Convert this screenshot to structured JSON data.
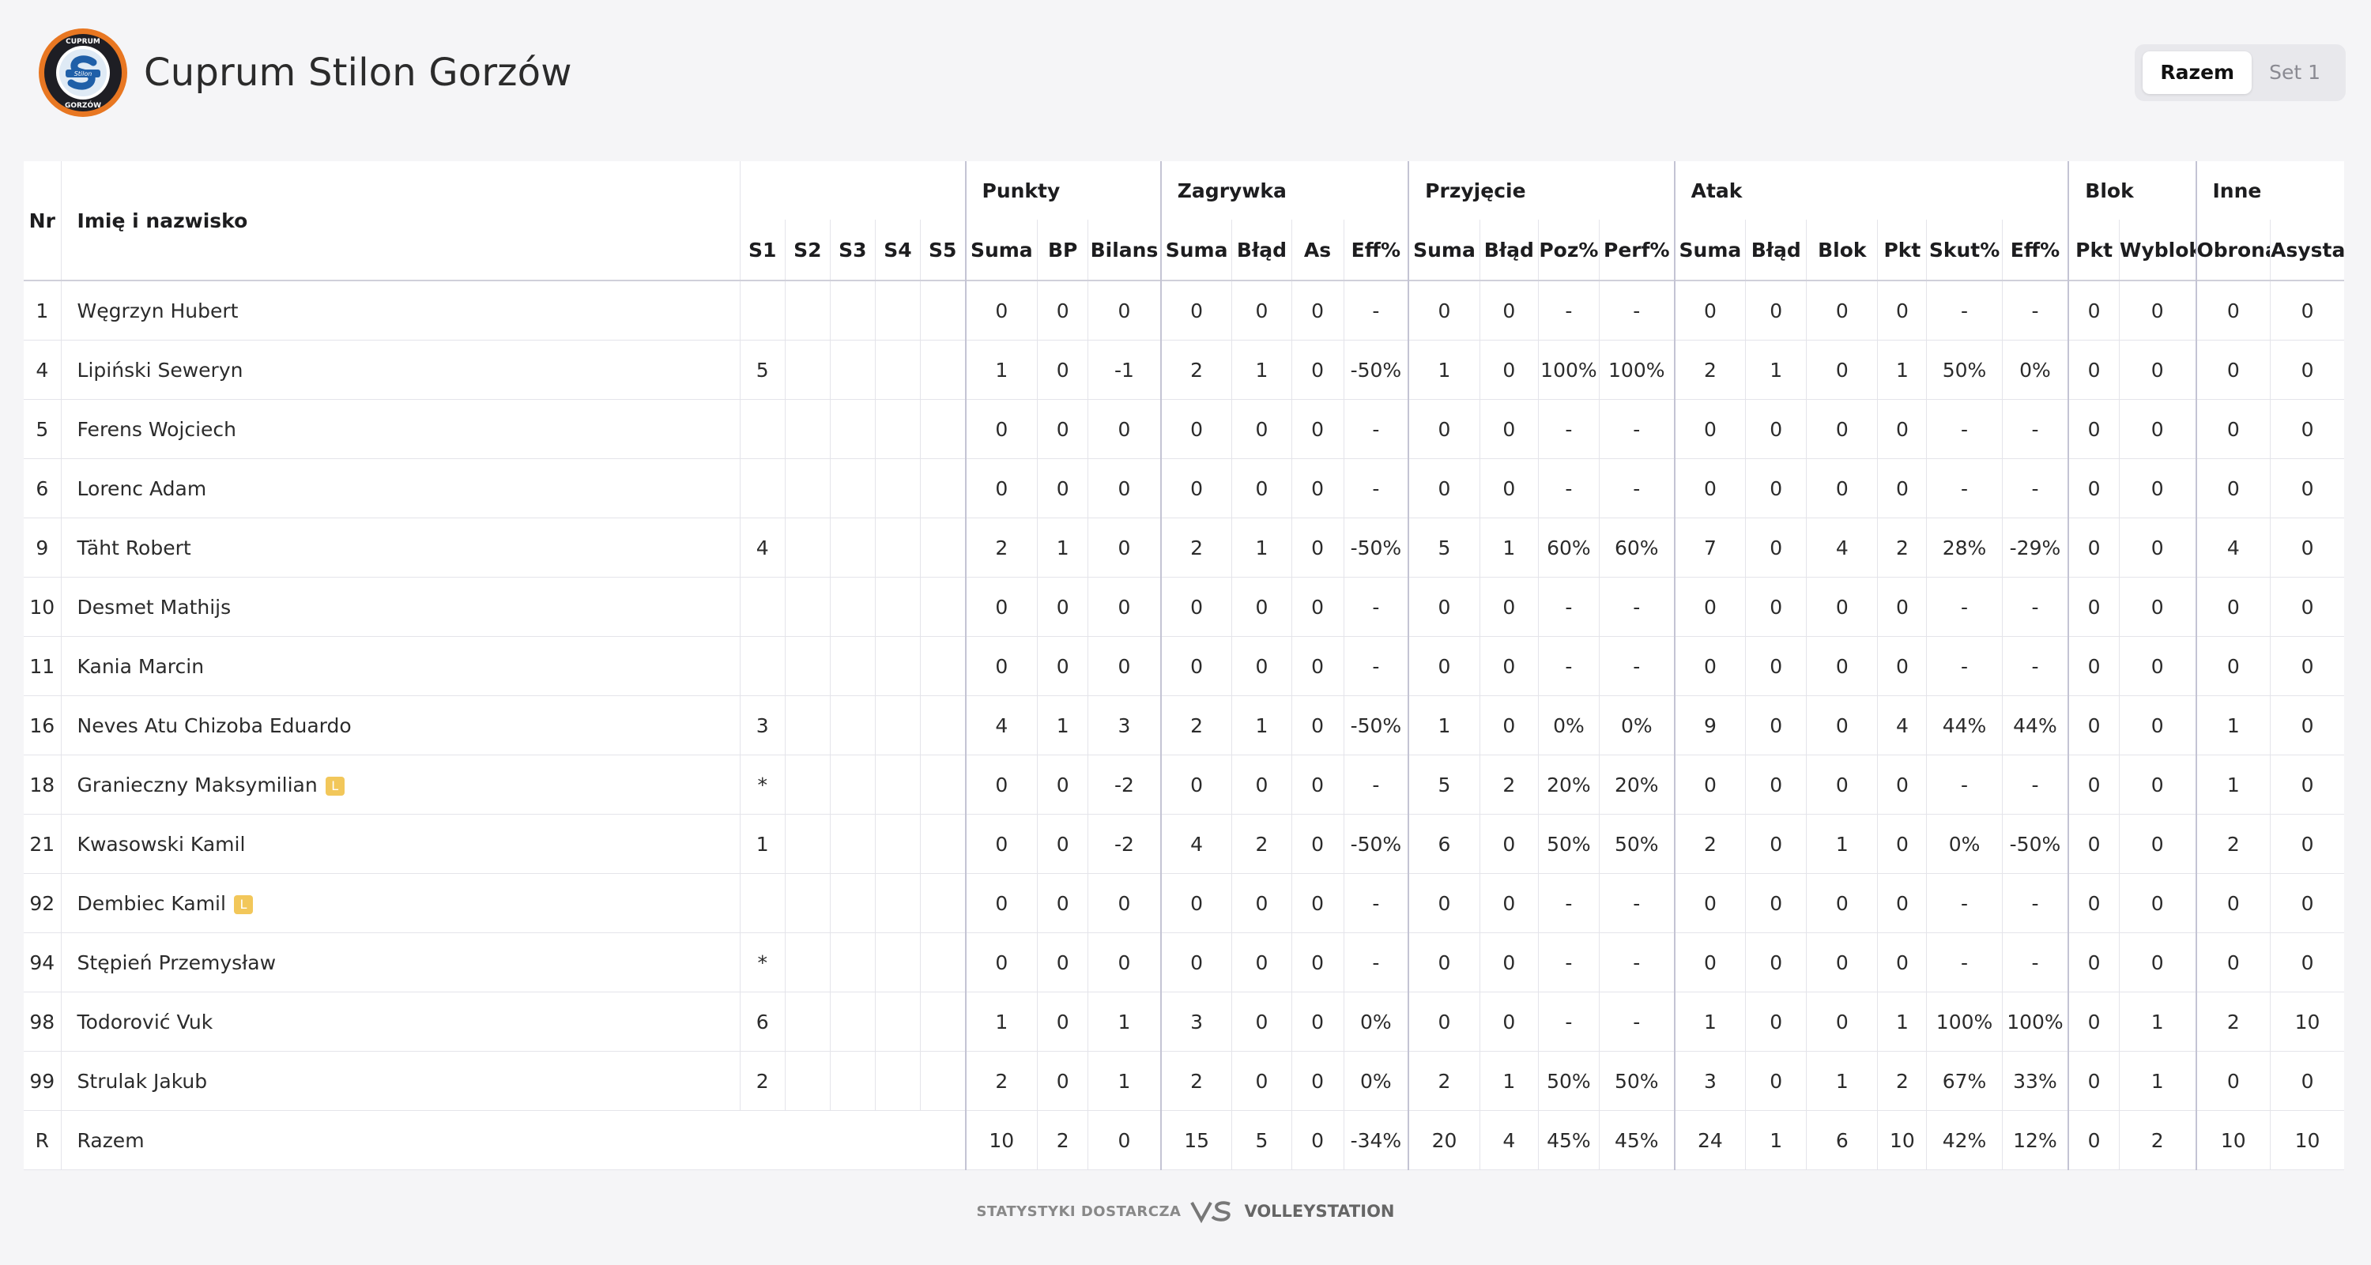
{
  "team": {
    "name": "Cuprum Stilon Gorzów",
    "logo_text_top": "CUPRUM",
    "logo_text_bottom": "GORZÓW",
    "logo_text_mid": "Stilon"
  },
  "tabs": [
    {
      "label": "Razem",
      "active": true
    },
    {
      "label": "Set 1",
      "active": false
    }
  ],
  "table": {
    "headers": {
      "nr": "Nr",
      "name": "Imię i nazwisko",
      "groups": [
        "",
        "Punkty",
        "Zagrywka",
        "Przyjęcie",
        "Atak",
        "Blok",
        "Inne"
      ],
      "columns": [
        "S1",
        "S2",
        "S3",
        "S4",
        "S5",
        "Suma",
        "BP",
        "Bilans",
        "Suma",
        "Błąd",
        "As",
        "Eff%",
        "Suma",
        "Błąd",
        "Poz%",
        "Perf%",
        "Suma",
        "Błąd",
        "Blok",
        "Pkt",
        "Skut%",
        "Eff%",
        "Pkt",
        "Wyblok",
        "Obrona",
        "Asysta"
      ]
    },
    "rows": [
      {
        "nr": "1",
        "name": "Węgrzyn Hubert",
        "libero": false,
        "cells": [
          "",
          "",
          "",
          "",
          "",
          "0",
          "0",
          "0",
          "0",
          "0",
          "0",
          "-",
          "0",
          "0",
          "-",
          "-",
          "0",
          "0",
          "0",
          "0",
          "-",
          "-",
          "0",
          "0",
          "0",
          "0"
        ]
      },
      {
        "nr": "4",
        "name": "Lipiński Seweryn",
        "libero": false,
        "cells": [
          "5",
          "",
          "",
          "",
          "",
          "1",
          "0",
          "-1",
          "2",
          "1",
          "0",
          "-50%",
          "1",
          "0",
          "100%",
          "100%",
          "2",
          "1",
          "0",
          "1",
          "50%",
          "0%",
          "0",
          "0",
          "0",
          "0"
        ]
      },
      {
        "nr": "5",
        "name": "Ferens Wojciech",
        "libero": false,
        "cells": [
          "",
          "",
          "",
          "",
          "",
          "0",
          "0",
          "0",
          "0",
          "0",
          "0",
          "-",
          "0",
          "0",
          "-",
          "-",
          "0",
          "0",
          "0",
          "0",
          "-",
          "-",
          "0",
          "0",
          "0",
          "0"
        ]
      },
      {
        "nr": "6",
        "name": "Lorenc Adam",
        "libero": false,
        "cells": [
          "",
          "",
          "",
          "",
          "",
          "0",
          "0",
          "0",
          "0",
          "0",
          "0",
          "-",
          "0",
          "0",
          "-",
          "-",
          "0",
          "0",
          "0",
          "0",
          "-",
          "-",
          "0",
          "0",
          "0",
          "0"
        ]
      },
      {
        "nr": "9",
        "name": "Täht Robert",
        "libero": false,
        "cells": [
          "4",
          "",
          "",
          "",
          "",
          "2",
          "1",
          "0",
          "2",
          "1",
          "0",
          "-50%",
          "5",
          "1",
          "60%",
          "60%",
          "7",
          "0",
          "4",
          "2",
          "28%",
          "-29%",
          "0",
          "0",
          "4",
          "0"
        ]
      },
      {
        "nr": "10",
        "name": "Desmet Mathijs",
        "libero": false,
        "cells": [
          "",
          "",
          "",
          "",
          "",
          "0",
          "0",
          "0",
          "0",
          "0",
          "0",
          "-",
          "0",
          "0",
          "-",
          "-",
          "0",
          "0",
          "0",
          "0",
          "-",
          "-",
          "0",
          "0",
          "0",
          "0"
        ]
      },
      {
        "nr": "11",
        "name": "Kania Marcin",
        "libero": false,
        "cells": [
          "",
          "",
          "",
          "",
          "",
          "0",
          "0",
          "0",
          "0",
          "0",
          "0",
          "-",
          "0",
          "0",
          "-",
          "-",
          "0",
          "0",
          "0",
          "0",
          "-",
          "-",
          "0",
          "0",
          "0",
          "0"
        ]
      },
      {
        "nr": "16",
        "name": "Neves Atu Chizoba Eduardo",
        "libero": false,
        "cells": [
          "3",
          "",
          "",
          "",
          "",
          "4",
          "1",
          "3",
          "2",
          "1",
          "0",
          "-50%",
          "1",
          "0",
          "0%",
          "0%",
          "9",
          "0",
          "0",
          "4",
          "44%",
          "44%",
          "0",
          "0",
          "1",
          "0"
        ]
      },
      {
        "nr": "18",
        "name": "Granieczny Maksymilian",
        "libero": true,
        "cells": [
          "*",
          "",
          "",
          "",
          "",
          "0",
          "0",
          "-2",
          "0",
          "0",
          "0",
          "-",
          "5",
          "2",
          "20%",
          "20%",
          "0",
          "0",
          "0",
          "0",
          "-",
          "-",
          "0",
          "0",
          "1",
          "0"
        ]
      },
      {
        "nr": "21",
        "name": "Kwasowski Kamil",
        "libero": false,
        "cells": [
          "1",
          "",
          "",
          "",
          "",
          "0",
          "0",
          "-2",
          "4",
          "2",
          "0",
          "-50%",
          "6",
          "0",
          "50%",
          "50%",
          "2",
          "0",
          "1",
          "0",
          "0%",
          "-50%",
          "0",
          "0",
          "2",
          "0"
        ]
      },
      {
        "nr": "92",
        "name": "Dembiec Kamil",
        "libero": true,
        "cells": [
          "",
          "",
          "",
          "",
          "",
          "0",
          "0",
          "0",
          "0",
          "0",
          "0",
          "-",
          "0",
          "0",
          "-",
          "-",
          "0",
          "0",
          "0",
          "0",
          "-",
          "-",
          "0",
          "0",
          "0",
          "0"
        ]
      },
      {
        "nr": "94",
        "name": "Stępień Przemysław",
        "libero": false,
        "cells": [
          "*",
          "",
          "",
          "",
          "",
          "0",
          "0",
          "0",
          "0",
          "0",
          "0",
          "-",
          "0",
          "0",
          "-",
          "-",
          "0",
          "0",
          "0",
          "0",
          "-",
          "-",
          "0",
          "0",
          "0",
          "0"
        ]
      },
      {
        "nr": "98",
        "name": "Todorović Vuk",
        "libero": false,
        "cells": [
          "6",
          "",
          "",
          "",
          "",
          "1",
          "0",
          "1",
          "3",
          "0",
          "0",
          "0%",
          "0",
          "0",
          "-",
          "-",
          "1",
          "0",
          "0",
          "1",
          "100%",
          "100%",
          "0",
          "1",
          "2",
          "10"
        ]
      },
      {
        "nr": "99",
        "name": "Strulak Jakub",
        "libero": false,
        "cells": [
          "2",
          "",
          "",
          "",
          "",
          "2",
          "0",
          "1",
          "2",
          "0",
          "0",
          "0%",
          "2",
          "1",
          "50%",
          "50%",
          "3",
          "0",
          "1",
          "2",
          "67%",
          "33%",
          "0",
          "1",
          "0",
          "0"
        ]
      }
    ],
    "libero_badge": "L",
    "total": {
      "nr": "R",
      "name": "Razem",
      "cells": [
        "10",
        "2",
        "0",
        "15",
        "5",
        "0",
        "-34%",
        "20",
        "4",
        "45%",
        "45%",
        "24",
        "1",
        "6",
        "10",
        "42%",
        "12%",
        "0",
        "2",
        "10",
        "10"
      ]
    }
  },
  "footer": {
    "provided_by": "STATYSTYKI DOSTARCZA",
    "brand": "VOLLEYSTATION"
  },
  "colors": {
    "background": "#f5f5f7",
    "libero_badge": "#f2c75a",
    "group_divider": "#c4c4d4"
  }
}
